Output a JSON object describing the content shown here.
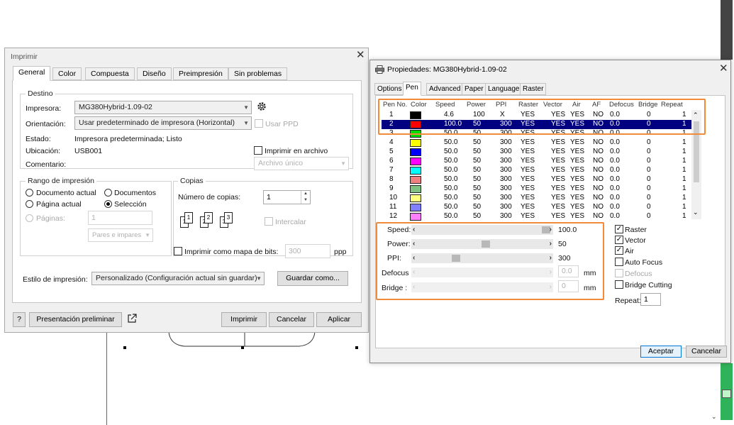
{
  "print_dialog": {
    "title": "Imprimir",
    "close": "✕",
    "tabs": [
      "General",
      "Color",
      "Compuesta",
      "Diseño",
      "Preimpresión",
      "Sin problemas"
    ],
    "destino": {
      "group_label": "Destino",
      "impresora_label": "Impresora:",
      "impresora_value": "MG380Hybrid-1.09-02",
      "orientacion_label": "Orientación:",
      "orientacion_value": "Usar predeterminado de impresora (Horizontal)",
      "usar_ppd": "Usar PPD",
      "estado_label": "Estado:",
      "estado_value": "Impresora predeterminada; Listo",
      "ubicacion_label": "Ubicación:",
      "ubicacion_value": "USB001",
      "comentario_label": "Comentario:",
      "imprimir_archivo": "Imprimir en archivo",
      "archivo_unico": "Archivo único"
    },
    "rango": {
      "group_label": "Rango de impresión",
      "documento_actual": "Documento actual",
      "documentos": "Documentos",
      "pagina_actual": "Página actual",
      "seleccion": "Selección",
      "paginas_label": "Páginas:",
      "paginas_value": "1",
      "pares_impares": "Pares e impares"
    },
    "copias": {
      "group_label": "Copias",
      "numero_label": "Número de copias:",
      "numero_value": "1",
      "intercalar": "Intercalar",
      "page_icons": [
        "1",
        "1",
        "2",
        "2",
        "3",
        "3"
      ]
    },
    "mapa_bits": {
      "label": "Imprimir como mapa de bits:",
      "value": "300",
      "unit": "ppp"
    },
    "estilo": {
      "label": "Estilo de impresión:",
      "value": "Personalizado (Configuración actual sin guardar)",
      "guardar_como": "Guardar como..."
    },
    "footer": {
      "help": "?",
      "preview": "Presentación preliminar",
      "imprimir": "Imprimir",
      "cancelar": "Cancelar",
      "aplicar": "Aplicar"
    }
  },
  "props_dialog": {
    "title": "Propiedades: MG380Hybrid-1.09-02",
    "close": "✕",
    "tabs": [
      "Options",
      "Pen",
      "Advanced",
      "Paper",
      "Language",
      "Raster"
    ],
    "columns": [
      "Pen No.",
      "Color",
      "Speed",
      "Power",
      "PPI",
      "Raster",
      "Vector",
      "Air",
      "AF",
      "Defocus",
      "Bridge",
      "Repeat"
    ],
    "rows": [
      {
        "pen": "1",
        "color": "#000000",
        "speed": "4.6",
        "power": "100",
        "ppi": "X",
        "raster": "YES",
        "vector": "YES",
        "air": "YES",
        "af": "NO",
        "defocus": "0.0",
        "bridge": "0",
        "repeat": "1"
      },
      {
        "pen": "2",
        "color": "#ff0000",
        "speed": "100.0",
        "power": "50",
        "ppi": "300",
        "raster": "YES",
        "vector": "YES",
        "air": "YES",
        "af": "NO",
        "defocus": "0.0",
        "bridge": "0",
        "repeat": "1"
      },
      {
        "pen": "3",
        "color": "#00dd00",
        "speed": "50.0",
        "power": "50",
        "ppi": "300",
        "raster": "YES",
        "vector": "YES",
        "air": "YES",
        "af": "NO",
        "defocus": "0.0",
        "bridge": "0",
        "repeat": "1"
      },
      {
        "pen": "4",
        "color": "#ffff00",
        "speed": "50.0",
        "power": "50",
        "ppi": "300",
        "raster": "YES",
        "vector": "YES",
        "air": "YES",
        "af": "NO",
        "defocus": "0.0",
        "bridge": "0",
        "repeat": "1"
      },
      {
        "pen": "5",
        "color": "#0000ff",
        "speed": "50.0",
        "power": "50",
        "ppi": "300",
        "raster": "YES",
        "vector": "YES",
        "air": "YES",
        "af": "NO",
        "defocus": "0.0",
        "bridge": "0",
        "repeat": "1"
      },
      {
        "pen": "6",
        "color": "#ff00ff",
        "speed": "50.0",
        "power": "50",
        "ppi": "300",
        "raster": "YES",
        "vector": "YES",
        "air": "YES",
        "af": "NO",
        "defocus": "0.0",
        "bridge": "0",
        "repeat": "1"
      },
      {
        "pen": "7",
        "color": "#00ffff",
        "speed": "50.0",
        "power": "50",
        "ppi": "300",
        "raster": "YES",
        "vector": "YES",
        "air": "YES",
        "af": "NO",
        "defocus": "0.0",
        "bridge": "0",
        "repeat": "1"
      },
      {
        "pen": "8",
        "color": "#f08080",
        "speed": "50.0",
        "power": "50",
        "ppi": "300",
        "raster": "YES",
        "vector": "YES",
        "air": "YES",
        "af": "NO",
        "defocus": "0.0",
        "bridge": "0",
        "repeat": "1"
      },
      {
        "pen": "9",
        "color": "#80c080",
        "speed": "50.0",
        "power": "50",
        "ppi": "300",
        "raster": "YES",
        "vector": "YES",
        "air": "YES",
        "af": "NO",
        "defocus": "0.0",
        "bridge": "0",
        "repeat": "1"
      },
      {
        "pen": "10",
        "color": "#ffff80",
        "speed": "50.0",
        "power": "50",
        "ppi": "300",
        "raster": "YES",
        "vector": "YES",
        "air": "YES",
        "af": "NO",
        "defocus": "0.0",
        "bridge": "0",
        "repeat": "1"
      },
      {
        "pen": "11",
        "color": "#8080ff",
        "speed": "50.0",
        "power": "50",
        "ppi": "300",
        "raster": "YES",
        "vector": "YES",
        "air": "YES",
        "af": "NO",
        "defocus": "0.0",
        "bridge": "0",
        "repeat": "1"
      },
      {
        "pen": "12",
        "color": "#ff80ff",
        "speed": "50.0",
        "power": "50",
        "ppi": "300",
        "raster": "YES",
        "vector": "YES",
        "air": "YES",
        "af": "NO",
        "defocus": "0.0",
        "bridge": "0",
        "repeat": "1"
      }
    ],
    "selected_row": 1,
    "sliders": {
      "speed_label": "Speed:",
      "speed_value": "100.0",
      "speed_level": 1.0,
      "power_label": "Power:",
      "power_value": "50",
      "power_level": 0.5,
      "ppi_label": "PPI:",
      "ppi_value": "300",
      "ppi_level": 0.25,
      "defocus_label": "Defocus",
      "defocus_value": "0.0",
      "defocus_unit": "mm",
      "bridge_label": "Bridge :",
      "bridge_value": "0",
      "bridge_unit": "mm"
    },
    "checks": {
      "raster": "Raster",
      "vector": "Vector",
      "air": "Air",
      "auto_focus": "Auto Focus",
      "defocus": "Defocus",
      "bridge_cutting": "Bridge Cutting",
      "repeat_label": "Repeat:",
      "repeat_value": "1"
    },
    "footer": {
      "aceptar": "Aceptar",
      "cancelar": "Cancelar"
    }
  },
  "accent_color": "#f28a3c",
  "selection_color": "#000080"
}
